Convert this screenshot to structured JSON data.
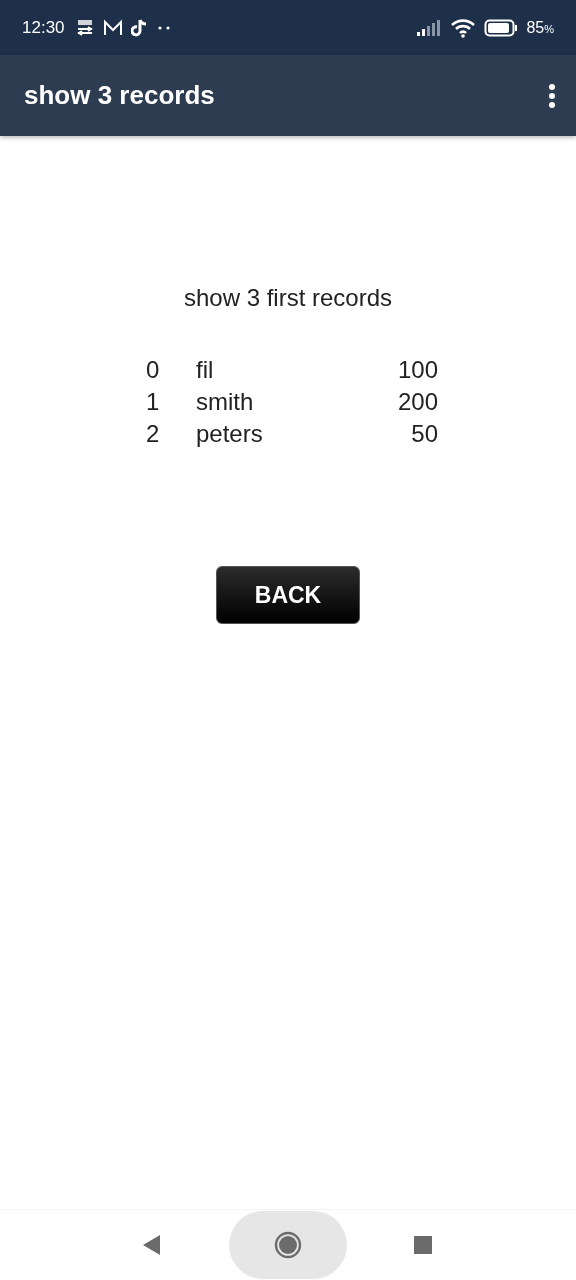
{
  "status_bar": {
    "time": "12:30",
    "battery": "85",
    "battery_unit": "%"
  },
  "app_bar": {
    "title": "show 3 records"
  },
  "content": {
    "heading": "show 3 first records",
    "rows": [
      {
        "index": "0",
        "name": "fil",
        "value": "100"
      },
      {
        "index": "1",
        "name": "smith",
        "value": "200"
      },
      {
        "index": "2",
        "name": "peters",
        "value": "50"
      }
    ],
    "button": "BACK"
  }
}
